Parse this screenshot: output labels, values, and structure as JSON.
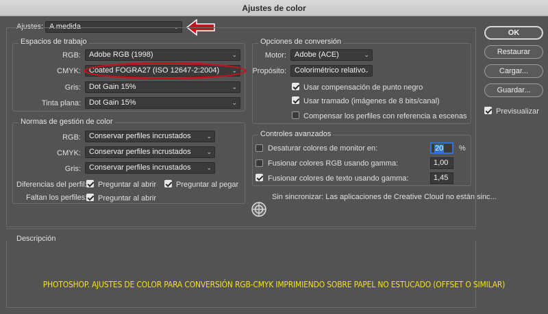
{
  "window_title": "Ajustes de color",
  "settings": {
    "label": "Ajustes:",
    "value": "A medida"
  },
  "working_spaces": {
    "title": "Espacios de trabajo",
    "rgb": {
      "label": "RGB:",
      "value": "Adobe RGB (1998)"
    },
    "cmyk": {
      "label": "CMYK:",
      "value": "Coated FOGRA27 (ISO 12647-2:2004)"
    },
    "gray": {
      "label": "Gris:",
      "value": "Dot Gain 15%"
    },
    "spot": {
      "label": "Tinta plana:",
      "value": "Dot Gain 15%"
    }
  },
  "policies": {
    "title": "Normas de gestión de color",
    "rgb": {
      "label": "RGB:",
      "value": "Conservar perfiles incrustados"
    },
    "cmyk": {
      "label": "CMYK:",
      "value": "Conservar perfiles incrustados"
    },
    "gray": {
      "label": "Gris:",
      "value": "Conservar perfiles incrustados"
    },
    "mismatch_label": "Diferencias del perfil:",
    "ask_open": "Preguntar al abrir",
    "ask_paste": "Preguntar al pegar",
    "missing_label": "Faltan los perfiles:",
    "ask_open_missing": "Preguntar al abrir"
  },
  "conversion": {
    "title": "Opciones de conversión",
    "engine": {
      "label": "Motor:",
      "value": "Adobe (ACE)"
    },
    "intent": {
      "label": "Propósito:",
      "value": "Colorimétrico relativo"
    },
    "bpc": "Usar compensación de punto negro",
    "dither": "Usar tramado (imágenes de 8 bits/canal)",
    "scene": "Compensar los perfiles con referencia a escenas"
  },
  "advanced": {
    "title": "Controles avanzados",
    "desaturate": {
      "label": "Desaturar colores de monitor en:",
      "value": "20",
      "unit": "%"
    },
    "blend_rgb": {
      "label": "Fusionar colores RGB usando gamma:",
      "value": "1,00"
    },
    "blend_text": {
      "label": "Fusionar colores de texto usando gamma:",
      "value": "1,45"
    }
  },
  "sync_status": "Sin sincronizar: Las aplicaciones de Creative Cloud no están sinc...",
  "description_title": "Descripción",
  "buttons": {
    "ok": "OK",
    "reset": "Restaurar",
    "load": "Cargar...",
    "save": "Guardar..."
  },
  "preview": "Previsualizar",
  "caption": "PHOTOSHOP. AJUSTES DE COLOR PARA CONVERSIÓN RGB-CMYK IMPRIMIENDO SOBRE PAPEL NO ESTUCADO (OFFSET O SIMILAR)",
  "colors": {
    "annotation_red": "#c4121e",
    "caption_yellow": "#f2e11c",
    "selection_blue": "#2e74d6"
  }
}
